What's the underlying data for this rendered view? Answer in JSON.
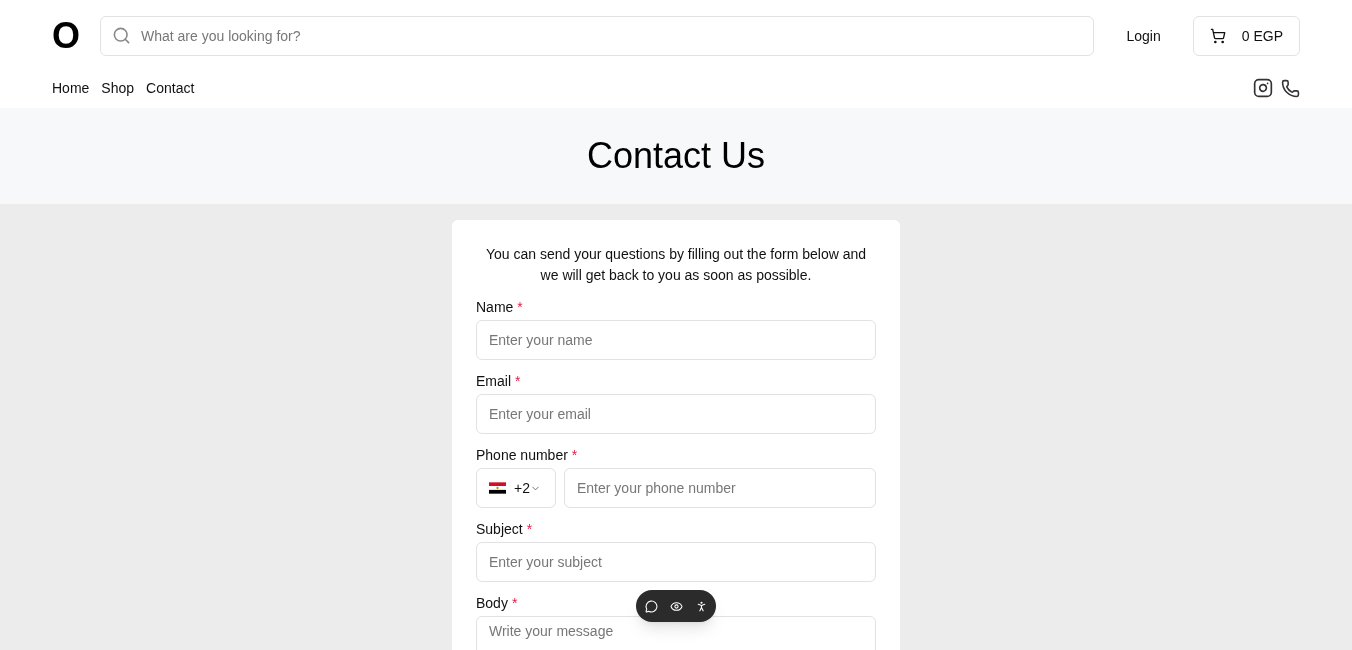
{
  "header": {
    "logo": "O",
    "search": {
      "placeholder": "What are you looking for?"
    },
    "login": "Login",
    "cart": "0 EGP"
  },
  "nav": [
    "Home",
    "Shop",
    "Contact"
  ],
  "hero": {
    "title": "Contact Us"
  },
  "form": {
    "intro": "You can send your questions by filling out the form below and we will get back to you as soon as possible.",
    "fields": [
      {
        "kind": "text",
        "label": "Name",
        "required_mark": "*",
        "placeholder": "Enter your name"
      },
      {
        "kind": "text",
        "label": "Email",
        "required_mark": "*",
        "placeholder": "Enter your email"
      },
      {
        "kind": "phone",
        "label": "Phone number",
        "required_mark": "*",
        "code": "+2",
        "placeholder": "Enter your phone number"
      },
      {
        "kind": "text",
        "label": "Subject",
        "required_mark": "*",
        "placeholder": "Enter your subject"
      },
      {
        "kind": "textarea",
        "label": "Body",
        "required_mark": "*",
        "placeholder": "Write your message"
      }
    ]
  }
}
